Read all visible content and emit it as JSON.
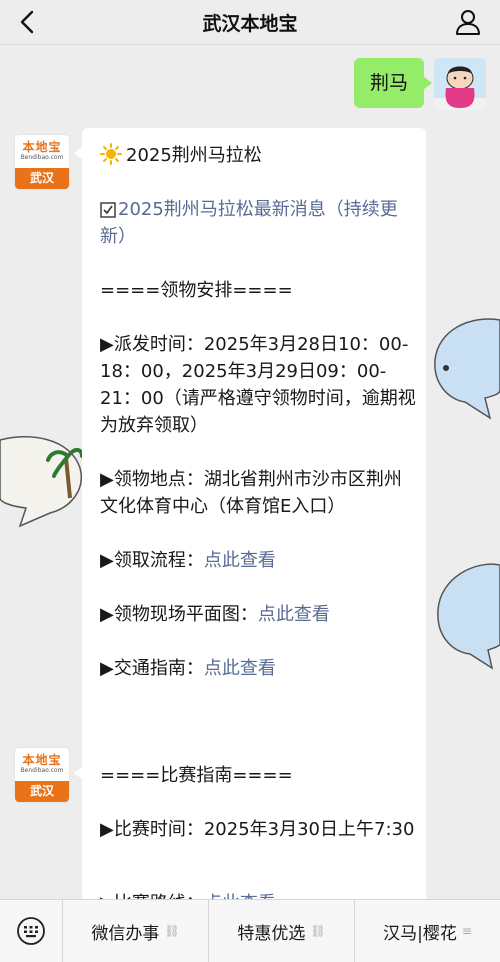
{
  "header": {
    "title": "武汉本地宝"
  },
  "user_message": {
    "text": "荆马"
  },
  "bot": {
    "logo_cn": "本地宝",
    "logo_en": "Bendibao.com",
    "logo_city": "武汉"
  },
  "message1": {
    "title": "2025荆州马拉松",
    "news_link": "2025荆州马拉松最新消息（持续更新）",
    "section_header": "====领物安排====",
    "dispatch_time": "▶派发时间：2025年3月28日10：00-18：00，2025年3月29日09：00-21：00（请严格遵守领物时间，逾期视为放弃领取）",
    "location": "▶领物地点：湖北省荆州市沙市区荆州文化体育中心（体育馆E入口）",
    "process_label": "▶领取流程：",
    "process_link": "点此查看",
    "map_label": "▶领物现场平面图：",
    "map_link": "点此查看",
    "traffic_label": "▶交通指南：",
    "traffic_link": "点此查看"
  },
  "message2": {
    "section_header": "====比赛指南====",
    "race_time": "▶比赛时间：2025年3月30日上午7:30",
    "route_label": "▶比赛路线：",
    "route_link": "点此查看"
  },
  "bottom_menu": [
    {
      "label": "微信办事",
      "icon": "link-icon"
    },
    {
      "label": "特惠优选",
      "icon": "link-icon"
    },
    {
      "label": "汉马|樱花",
      "icon": "menu-icon"
    }
  ],
  "colors": {
    "link": "#576b95",
    "user_bubble": "#95ec69",
    "brand": "#e8731a"
  }
}
